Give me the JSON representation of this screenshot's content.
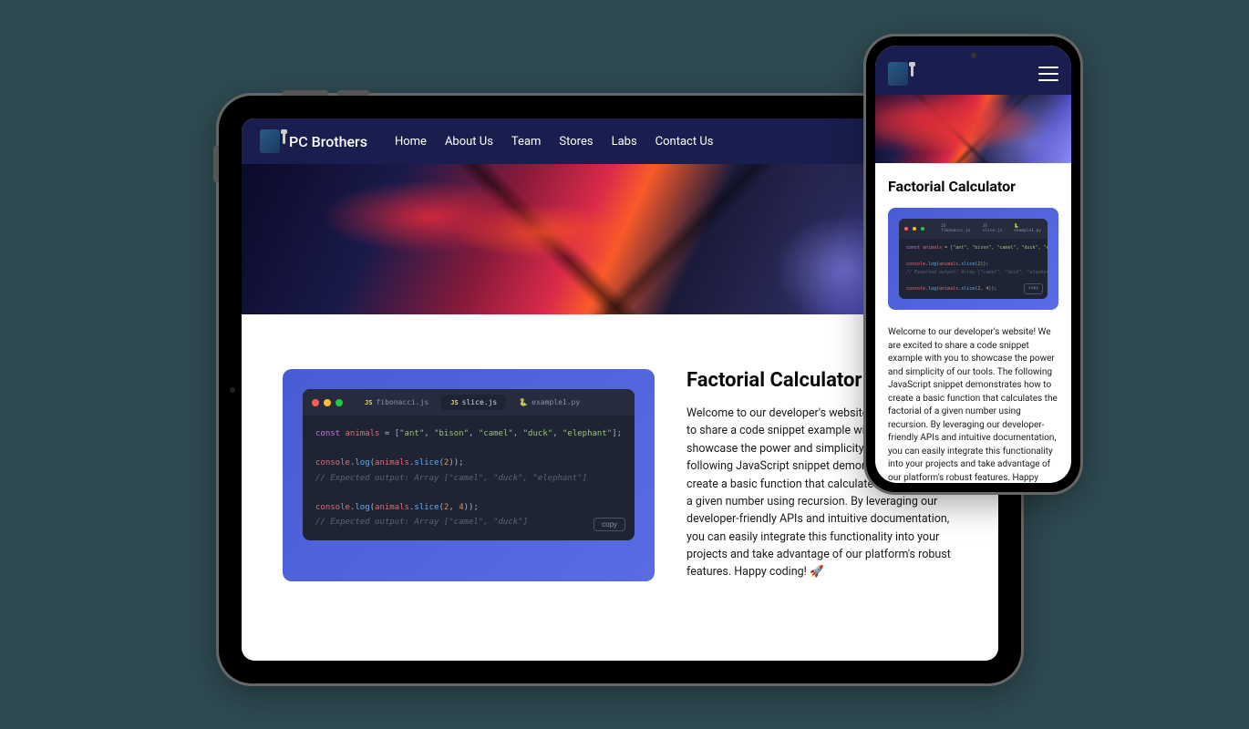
{
  "brand": "PC Brothers",
  "nav": {
    "items": [
      "Home",
      "About Us",
      "Team",
      "Stores",
      "Labs",
      "Contact Us"
    ]
  },
  "content": {
    "heading": "Factorial Calculator",
    "body": "Welcome to our developer's website! We are excited to share a code snippet example with you to showcase the power and simplicity of our tools. The following JavaScript snippet demonstrates how to create a basic function that calculates the factorial of a given number using recursion. By leveraging our developer-friendly APIs and intuitive documentation, you can easily integrate this functionality into your projects and take advantage of our platform's robust features. Happy coding! 🚀"
  },
  "code": {
    "tabs": [
      {
        "icon": "JS",
        "label": "fibonacci.js",
        "active": false
      },
      {
        "icon": "JS",
        "label": "slice.js",
        "active": true
      },
      {
        "icon": "🐍",
        "label": "example1.py",
        "active": false
      }
    ],
    "copy_label": "copy",
    "lines": {
      "l1_kw": "const",
      "l1_var": " animals",
      "l1_eq": " = [",
      "l1_s1": "\"ant\"",
      "l1_c1": ", ",
      "l1_s2": "\"bison\"",
      "l1_c2": ", ",
      "l1_s3": "\"camel\"",
      "l1_c3": ", ",
      "l1_s4": "\"duck\"",
      "l1_c4": ", ",
      "l1_s5": "\"elephant\"",
      "l1_end": "];",
      "l2_obj": "console",
      "l2_dot": ".",
      "l2_fn": "log",
      "l2_p1": "(",
      "l2_var": "animals",
      "l2_dot2": ".",
      "l2_fn2": "slice",
      "l2_p2": "(",
      "l2_num": "2",
      "l2_p3": "));",
      "l3_comment": "// Expected output: Array [\"camel\", \"duck\", \"elephant\"]",
      "l4_obj": "console",
      "l4_dot": ".",
      "l4_fn": "log",
      "l4_p1": "(",
      "l4_var": "animals",
      "l4_dot2": ".",
      "l4_fn2": "slice",
      "l4_p2": "(",
      "l4_num1": "2",
      "l4_c": ", ",
      "l4_num2": "4",
      "l4_p3": "));",
      "l5_comment": "// Expected output: Array [\"camel\", \"duck\"]"
    }
  }
}
